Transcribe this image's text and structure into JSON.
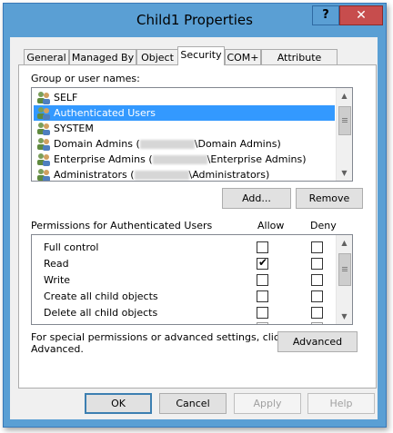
{
  "window": {
    "title": "Child1 Properties",
    "help_label": "?",
    "close_label": "✕"
  },
  "tabs": [
    {
      "label": "General"
    },
    {
      "label": "Managed By"
    },
    {
      "label": "Object"
    },
    {
      "label": "Security"
    },
    {
      "label": "COM+"
    },
    {
      "label": "Attribute Editor"
    }
  ],
  "active_tab": "Security",
  "principals": {
    "header": "Group or user names:",
    "items": [
      {
        "prefix": "SELF",
        "suffix": ""
      },
      {
        "prefix": "Authenticated Users",
        "suffix": ""
      },
      {
        "prefix": "SYSTEM",
        "suffix": ""
      },
      {
        "prefix": "Domain Admins (",
        "suffix": "\\Domain Admins)"
      },
      {
        "prefix": "Enterprise Admins (",
        "suffix": "\\Enterprise Admins)"
      },
      {
        "prefix": "Administrators (",
        "suffix": "\\Administrators)"
      }
    ],
    "selected": "Authenticated Users",
    "add_button": "Add...",
    "remove_button": "Remove"
  },
  "permissions": {
    "header": "Permissions for Authenticated Users",
    "allow_header": "Allow",
    "deny_header": "Deny",
    "rows": [
      {
        "name": "Full control",
        "allow": false,
        "deny": false
      },
      {
        "name": "Read",
        "allow": true,
        "deny": false
      },
      {
        "name": "Write",
        "allow": false,
        "deny": false
      },
      {
        "name": "Create all child objects",
        "allow": false,
        "deny": false
      },
      {
        "name": "Delete all child objects",
        "allow": false,
        "deny": false
      }
    ]
  },
  "special": {
    "text_line1": "For special permissions or advanced settings, click",
    "text_line2": "Advanced.",
    "advanced_button": "Advanced"
  },
  "footer": {
    "ok": "OK",
    "cancel": "Cancel",
    "apply": "Apply",
    "help": "Help"
  },
  "colors": {
    "titlebar": "#5a9fd4",
    "selection": "#3399ff",
    "close_button": "#c74d4d"
  }
}
